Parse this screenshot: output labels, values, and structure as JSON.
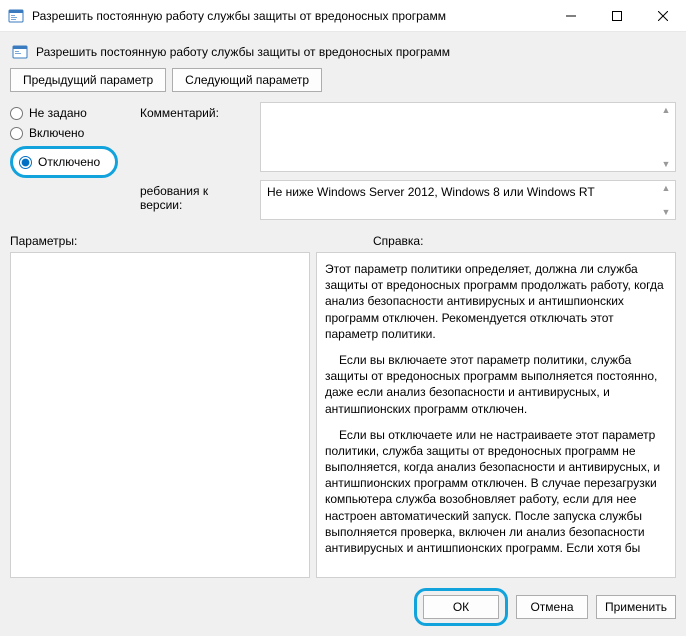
{
  "window": {
    "title": "Разрешить постоянную работу службы защиты от вредоносных программ",
    "subtitle": "Разрешить постоянную работу службы защиты от вредоносных программ"
  },
  "nav": {
    "prev": "Предыдущий параметр",
    "next": "Следующий параметр"
  },
  "state": {
    "radios": {
      "not_configured": "Не задано",
      "enabled": "Включено",
      "disabled": "Отключено"
    },
    "selected": "disabled"
  },
  "labels": {
    "comment": "Комментарий:",
    "requirements": "ребования к версии:",
    "options": "Параметры:",
    "help": "Справка:"
  },
  "requirements_text": "Не ниже Windows Server 2012, Windows 8 или Windows RT",
  "help_paragraphs": {
    "p1": "Этот параметр политики определяет, должна ли служба защиты от вредоносных программ продолжать работу, когда анализ безопасности антивирусных и антишпионских программ отключен. Рекомендуется отключать этот параметр политики.",
    "p2": "Если вы включаете этот параметр политики, служба защиты от вредоносных программ выполняется постоянно, даже если анализ безопасности и антивирусных, и антишпионских программ отключен.",
    "p3": "Если вы отключаете или не настраиваете этот параметр политики, служба защиты от вредоносных программ не выполняется, когда анализ безопасности и антивирусных, и антишпионских программ отключен. В случае перезагрузки компьютера служба возобновляет работу, если для нее настроен автоматический запуск. После запуска службы выполняется проверка, включен ли анализ безопасности антивирусных и антишпионских программ. Если хотя бы"
  },
  "footer": {
    "ok": "ОК",
    "cancel": "Отмена",
    "apply": "Применить"
  },
  "colors": {
    "highlight": "#12a3dd",
    "bg": "#f0f0f0"
  }
}
